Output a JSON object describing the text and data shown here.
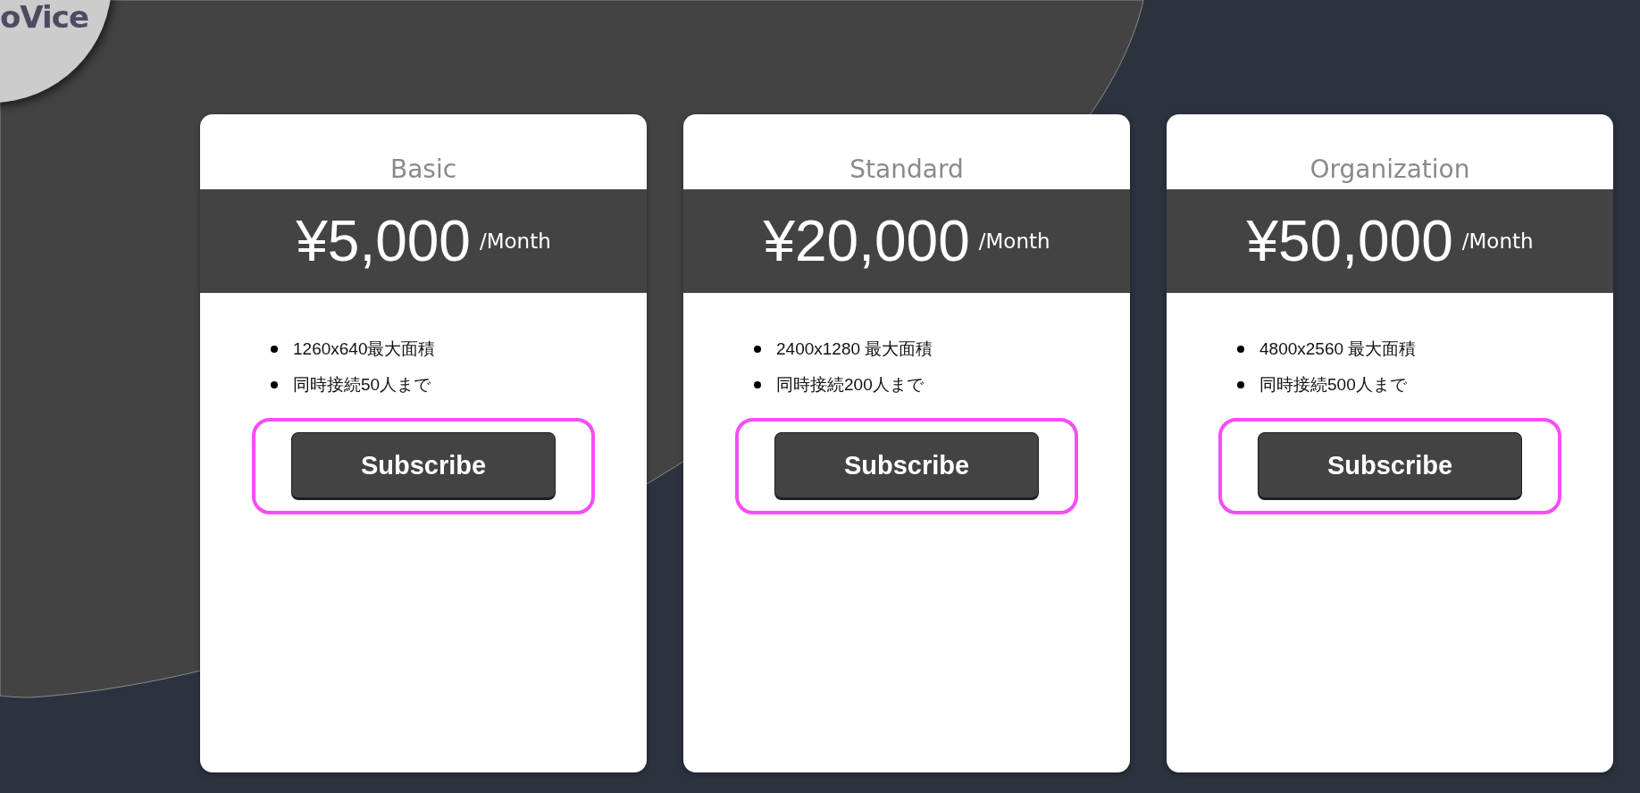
{
  "logo": {
    "text": "oVice"
  },
  "plans": [
    {
      "name": "Basic",
      "price": "¥5,000",
      "period": "/Month",
      "features": [
        "1260x640最大面積",
        "同時接続50人まで"
      ],
      "button": "Subscribe",
      "highlighted": true
    },
    {
      "name": "Standard",
      "price": "¥20,000",
      "period": "/Month",
      "features": [
        "2400x1280 最大面積",
        "同時接続200人まで"
      ],
      "button": "Subscribe",
      "highlighted": true
    },
    {
      "name": "Organization",
      "price": "¥50,000",
      "period": "/Month",
      "features": [
        "4800x2560 最大面積",
        "同時接続500人まで"
      ],
      "button": "Subscribe",
      "highlighted": true
    }
  ]
}
